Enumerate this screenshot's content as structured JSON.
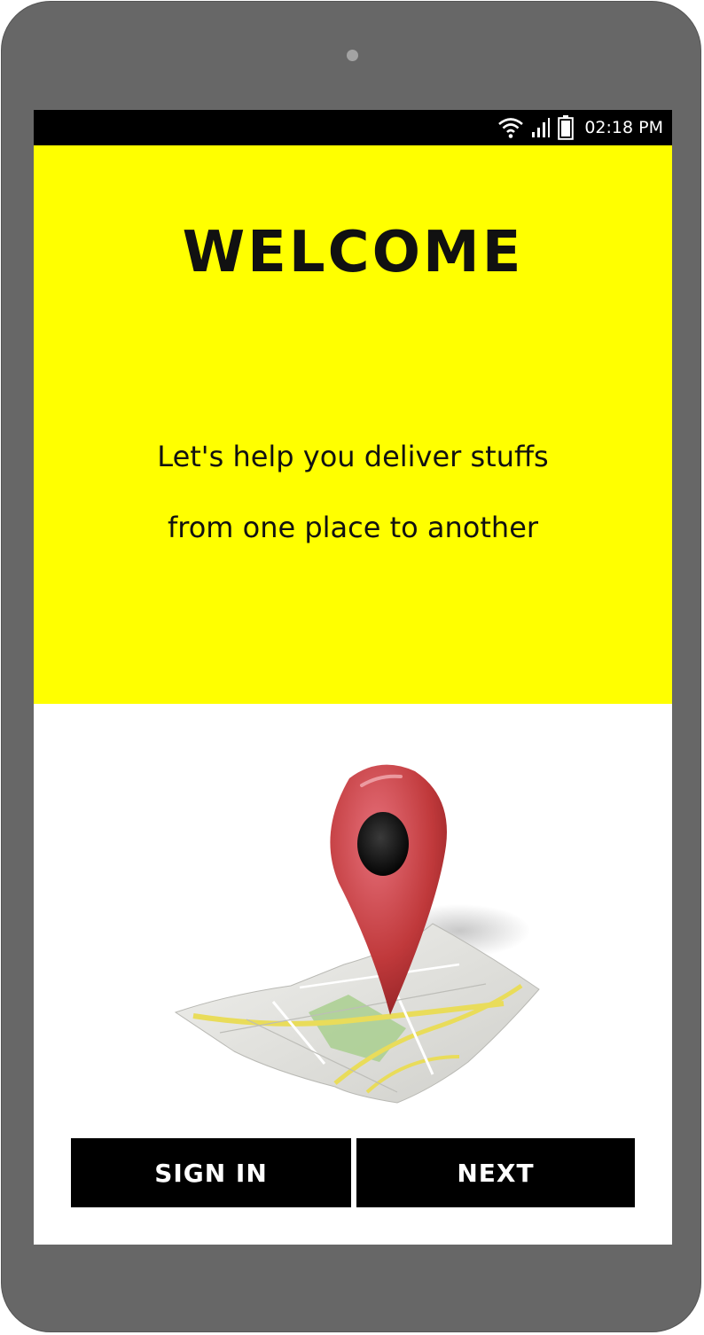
{
  "status_bar": {
    "time": "02:18 PM",
    "icons": [
      "wifi-icon",
      "signal-icon",
      "battery-icon"
    ]
  },
  "hero": {
    "title": "WELCOME",
    "tagline_line1": "Let's help you deliver stuffs",
    "tagline_line2": "from one place to another",
    "background_color": "#ffff00"
  },
  "illustration": {
    "icon": "map-pin-illustration",
    "pin_color": "#c0393b"
  },
  "actions": {
    "signin_label": "SIGN IN",
    "next_label": "NEXT"
  }
}
